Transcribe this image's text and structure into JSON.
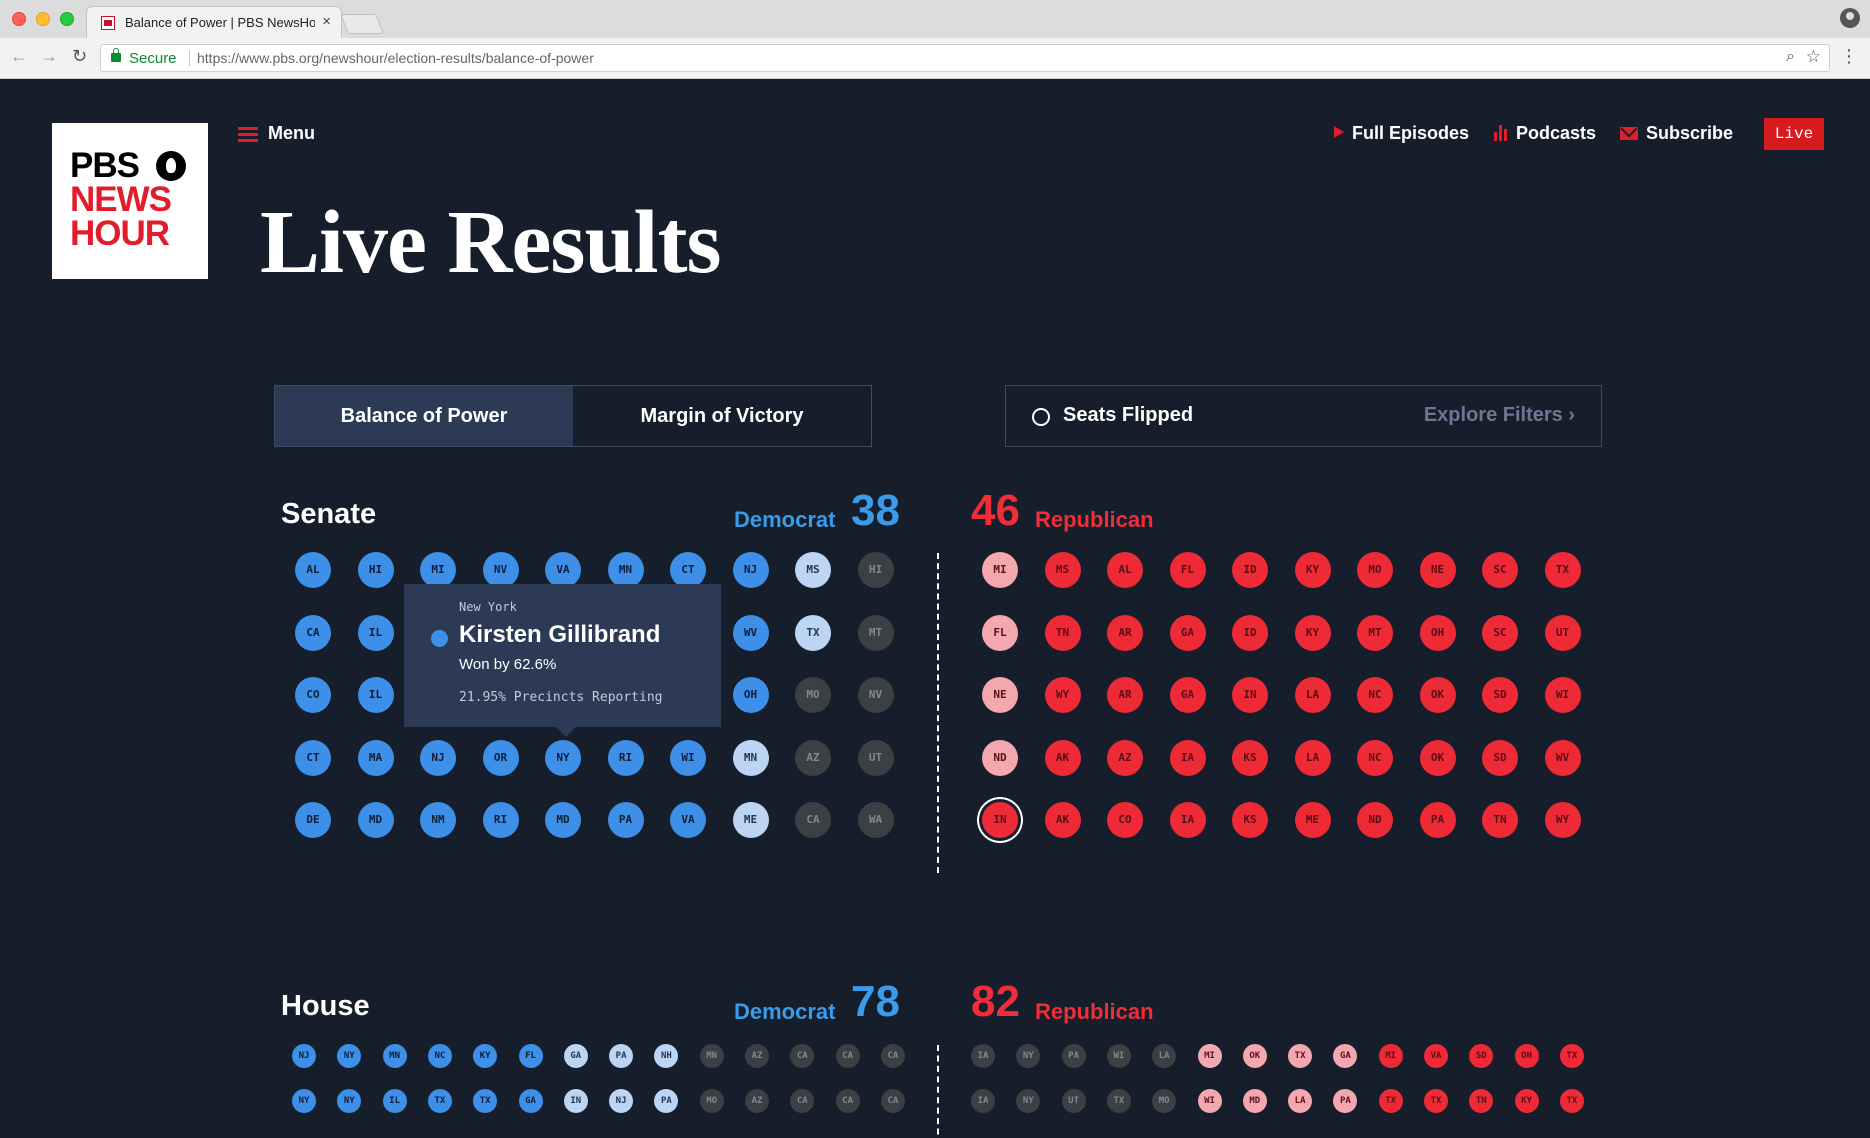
{
  "browser": {
    "tab_title": "Balance of Power | PBS NewsHour",
    "tab_close": "×",
    "secure_label": "Secure",
    "url": "https://www.pbs.org/newshour/election-results/balance-of-power"
  },
  "logo": {
    "line1": "PBS",
    "line2": "NEWS",
    "line3": "HOUR"
  },
  "header": {
    "menu_label": "Menu",
    "nav": {
      "full_episodes": "Full Episodes",
      "podcasts": "Podcasts",
      "subscribe": "Subscribe",
      "live": "Live"
    }
  },
  "page_title": "Live Results",
  "view_tabs": {
    "balance": "Balance of Power",
    "margin": "Margin of Victory"
  },
  "filters": {
    "seats_flipped": "Seats Flipped",
    "explore": "Explore Filters ›"
  },
  "colors": {
    "dem": "#3d8fe8",
    "dem_light": "#bcd5f4",
    "undecided": "#3c3f44",
    "rep_light": "#f2a8ae",
    "rep": "#ee2a36",
    "live": "#d71920"
  },
  "senate": {
    "title": "Senate",
    "dem_label": "Democrat",
    "dem_count": "38",
    "rep_count": "46",
    "rep_label": "Republican",
    "left_rows": [
      [
        [
          "AL",
          "dem"
        ],
        [
          "HI",
          "dem"
        ],
        [
          "MI",
          "dem"
        ],
        [
          "NV",
          "dem"
        ],
        [
          "VA",
          "dem"
        ],
        [
          "MN",
          "dem"
        ],
        [
          "CT",
          "dem"
        ],
        [
          "NJ",
          "dem"
        ],
        [
          "MS",
          "demlt"
        ],
        [
          "HI",
          "gray"
        ]
      ],
      [
        [
          "CA",
          "dem"
        ],
        [
          "IL",
          "dem"
        ],
        [
          "",
          "dem"
        ],
        [
          "",
          "dem"
        ],
        [
          "",
          "dem"
        ],
        [
          "",
          "dem"
        ],
        [
          "",
          "dem"
        ],
        [
          "WV",
          "dem"
        ],
        [
          "TX",
          "demlt"
        ],
        [
          "MT",
          "gray"
        ]
      ],
      [
        [
          "CO",
          "dem"
        ],
        [
          "IL",
          "dem"
        ],
        [
          "",
          "dem"
        ],
        [
          "",
          "dem"
        ],
        [
          "",
          "dem"
        ],
        [
          "",
          "dem"
        ],
        [
          "",
          "dem"
        ],
        [
          "OH",
          "dem"
        ],
        [
          "MO",
          "gray"
        ],
        [
          "NV",
          "gray"
        ]
      ],
      [
        [
          "CT",
          "dem"
        ],
        [
          "MA",
          "dem"
        ],
        [
          "NJ",
          "dem"
        ],
        [
          "OR",
          "dem"
        ],
        [
          "NY",
          "dem"
        ],
        [
          "RI",
          "dem"
        ],
        [
          "WI",
          "dem"
        ],
        [
          "MN",
          "demlt"
        ],
        [
          "AZ",
          "gray"
        ],
        [
          "UT",
          "gray"
        ]
      ],
      [
        [
          "DE",
          "dem"
        ],
        [
          "MD",
          "dem"
        ],
        [
          "NM",
          "dem"
        ],
        [
          "RI",
          "dem"
        ],
        [
          "MD",
          "dem"
        ],
        [
          "PA",
          "dem"
        ],
        [
          "VA",
          "dem"
        ],
        [
          "ME",
          "demlt"
        ],
        [
          "CA",
          "gray"
        ],
        [
          "WA",
          "gray"
        ]
      ]
    ],
    "right_rows": [
      [
        [
          "MI",
          "replt"
        ],
        [
          "MS",
          "rep"
        ],
        [
          "AL",
          "rep"
        ],
        [
          "FL",
          "rep"
        ],
        [
          "ID",
          "rep"
        ],
        [
          "KY",
          "rep"
        ],
        [
          "MO",
          "rep"
        ],
        [
          "NE",
          "rep"
        ],
        [
          "SC",
          "rep"
        ],
        [
          "TX",
          "rep"
        ]
      ],
      [
        [
          "FL",
          "replt"
        ],
        [
          "TN",
          "rep"
        ],
        [
          "AR",
          "rep"
        ],
        [
          "GA",
          "rep"
        ],
        [
          "ID",
          "rep"
        ],
        [
          "KY",
          "rep"
        ],
        [
          "MT",
          "rep"
        ],
        [
          "OH",
          "rep"
        ],
        [
          "SC",
          "rep"
        ],
        [
          "UT",
          "rep"
        ]
      ],
      [
        [
          "NE",
          "replt"
        ],
        [
          "WY",
          "rep"
        ],
        [
          "AR",
          "rep"
        ],
        [
          "GA",
          "rep"
        ],
        [
          "IN",
          "rep"
        ],
        [
          "LA",
          "rep"
        ],
        [
          "NC",
          "rep"
        ],
        [
          "OK",
          "rep"
        ],
        [
          "SD",
          "rep"
        ],
        [
          "WI",
          "rep"
        ]
      ],
      [
        [
          "ND",
          "replt"
        ],
        [
          "AK",
          "rep"
        ],
        [
          "AZ",
          "rep"
        ],
        [
          "IA",
          "rep"
        ],
        [
          "KS",
          "rep"
        ],
        [
          "LA",
          "rep"
        ],
        [
          "NC",
          "rep"
        ],
        [
          "OK",
          "rep"
        ],
        [
          "SD",
          "rep"
        ],
        [
          "WV",
          "rep"
        ]
      ],
      [
        [
          "IN",
          "rep",
          "sel"
        ],
        [
          "AK",
          "rep"
        ],
        [
          "CO",
          "rep"
        ],
        [
          "IA",
          "rep"
        ],
        [
          "KS",
          "rep"
        ],
        [
          "ME",
          "rep"
        ],
        [
          "ND",
          "rep"
        ],
        [
          "PA",
          "rep"
        ],
        [
          "TN",
          "rep"
        ],
        [
          "WY",
          "rep"
        ]
      ]
    ],
    "tooltip": {
      "state": "New York",
      "candidate": "Kirsten Gillibrand",
      "won_by": "Won by 62.6%",
      "reporting": "21.95% Precincts Reporting"
    }
  },
  "house": {
    "title": "House",
    "dem_label": "Democrat",
    "dem_count": "78",
    "rep_count": "82",
    "rep_label": "Republican",
    "left_rows": [
      [
        [
          "NJ",
          "dem"
        ],
        [
          "NY",
          "dem"
        ],
        [
          "MN",
          "dem"
        ],
        [
          "NC",
          "dem"
        ],
        [
          "KY",
          "dem"
        ],
        [
          "FL",
          "dem"
        ],
        [
          "GA",
          "demlt"
        ],
        [
          "PA",
          "demlt"
        ],
        [
          "NH",
          "demlt"
        ],
        [
          "MN",
          "gray"
        ],
        [
          "AZ",
          "gray"
        ],
        [
          "CA",
          "gray"
        ],
        [
          "CA",
          "gray"
        ],
        [
          "CA",
          "gray"
        ]
      ],
      [
        [
          "NY",
          "dem"
        ],
        [
          "NY",
          "dem"
        ],
        [
          "IL",
          "dem"
        ],
        [
          "TX",
          "dem"
        ],
        [
          "TX",
          "dem"
        ],
        [
          "GA",
          "dem"
        ],
        [
          "IN",
          "demlt"
        ],
        [
          "NJ",
          "demlt"
        ],
        [
          "PA",
          "demlt"
        ],
        [
          "MO",
          "gray"
        ],
        [
          "AZ",
          "gray"
        ],
        [
          "CA",
          "gray"
        ],
        [
          "CA",
          "gray"
        ],
        [
          "CA",
          "gray"
        ]
      ]
    ],
    "right_rows": [
      [
        [
          "IA",
          "gray"
        ],
        [
          "NY",
          "gray"
        ],
        [
          "PA",
          "gray"
        ],
        [
          "WI",
          "gray"
        ],
        [
          "LA",
          "gray"
        ],
        [
          "MI",
          "replt"
        ],
        [
          "OK",
          "replt"
        ],
        [
          "TX",
          "replt"
        ],
        [
          "GA",
          "replt"
        ],
        [
          "MI",
          "rep"
        ],
        [
          "VA",
          "rep"
        ],
        [
          "SD",
          "rep"
        ],
        [
          "OH",
          "rep"
        ],
        [
          "TX",
          "rep"
        ]
      ],
      [
        [
          "IA",
          "gray"
        ],
        [
          "NY",
          "gray"
        ],
        [
          "UT",
          "gray"
        ],
        [
          "TX",
          "gray"
        ],
        [
          "MO",
          "gray"
        ],
        [
          "WI",
          "replt"
        ],
        [
          "MD",
          "replt"
        ],
        [
          "LA",
          "replt"
        ],
        [
          "PA",
          "replt"
        ],
        [
          "TX",
          "rep"
        ],
        [
          "TX",
          "rep"
        ],
        [
          "TN",
          "rep"
        ],
        [
          "KY",
          "rep"
        ],
        [
          "TX",
          "rep"
        ]
      ]
    ]
  }
}
